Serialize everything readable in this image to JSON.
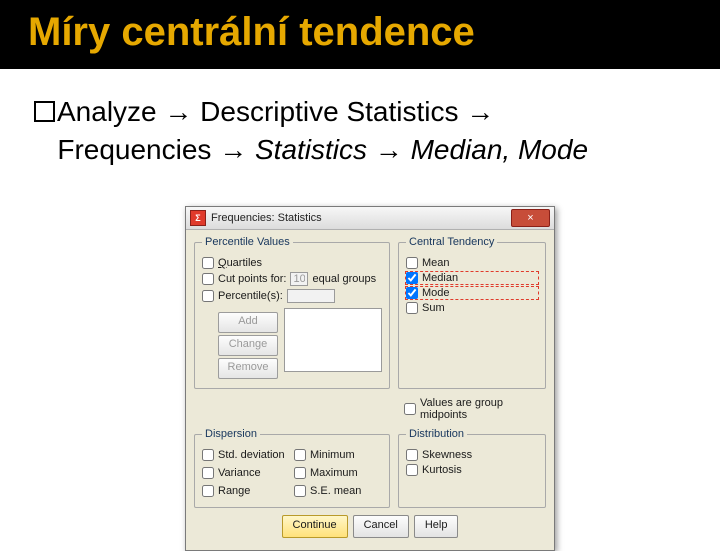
{
  "slide": {
    "title": "Míry centrální tendence",
    "bullet_prefix": "Analyze ",
    "arrow": "→",
    "bullet_mid1": " Descriptive Statistics ",
    "bullet_mid2": " Frequencies ",
    "bullet_stat": " Statistics ",
    "bullet_end": " Median, Mode"
  },
  "dialog": {
    "title": "Frequencies: Statistics",
    "close": "×",
    "groups": {
      "percentile": {
        "legend": "Percentile Values",
        "quartiles": "Quartiles",
        "cutpoints_pre": "Cut points for:",
        "cutpoints_value": "10",
        "cutpoints_post": "equal groups",
        "percentiles": "Percentile(s):",
        "buttons": {
          "add": "Add",
          "change": "Change",
          "remove": "Remove"
        }
      },
      "central": {
        "legend": "Central Tendency",
        "mean": "Mean",
        "median": "Median",
        "mode": "Mode",
        "sum": "Sum"
      },
      "midpoints": "Values are group midpoints",
      "dispersion": {
        "legend": "Dispersion",
        "std": "Std. deviation",
        "min": "Minimum",
        "var": "Variance",
        "max": "Maximum",
        "range": "Range",
        "se": "S.E. mean"
      },
      "distribution": {
        "legend": "Distribution",
        "skew": "Skewness",
        "kurt": "Kurtosis"
      }
    },
    "buttons": {
      "continue": "Continue",
      "cancel": "Cancel",
      "help": "Help"
    }
  }
}
